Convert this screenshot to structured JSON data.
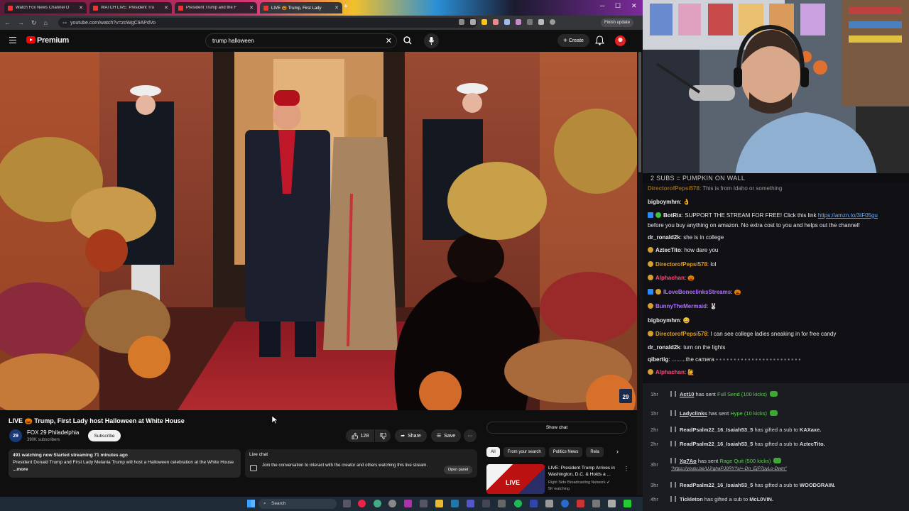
{
  "browser": {
    "tabs": [
      {
        "label": "Watch Fox News Channel O",
        "active": false
      },
      {
        "label": "WATCH LIVE: President Tru",
        "active": false
      },
      {
        "label": "President Trump and the F",
        "active": false
      },
      {
        "label": "LIVE 🎃 Trump, First Lady",
        "active": true
      }
    ],
    "url": "youtube.com/watch?v=zoWgC9APdVo",
    "finish_update": "Finish update"
  },
  "youtube": {
    "logo_text": "Premium",
    "search_value": "trump halloween",
    "create_label": "Create",
    "video_title": "LIVE 🎃 Trump, First Lady host Halloween at White House",
    "channel": {
      "name": "FOX 29 Philadelphia",
      "subs": "390K subscribers",
      "avatar_text": "29"
    },
    "subscribe_label": "Subscribe",
    "like_count": "128",
    "share_label": "Share",
    "save_label": "Save",
    "description": {
      "stats": "491 watching now  Started streaming 71 minutes ago",
      "text": "President Donald Trump and First Lady Melania Trump will host a Halloween celebration at the White House",
      "more": "...more"
    },
    "live_chat": {
      "title": "Live chat",
      "body": "Join the conversation to interact with the creator and others watching this live stream.",
      "open_label": "Open panel"
    },
    "show_chat": "Show chat",
    "chips": [
      "All",
      "From your search",
      "Politics News",
      "Rela"
    ],
    "recommendation": {
      "badge": "LIVE",
      "title": "LIVE: President Trump Arrives in Washington, D.C. & Holds a ...",
      "channel": "Right Side Broadcasting Network",
      "watching": "5K watching"
    },
    "video_watermark": "FOX 29"
  },
  "stream": {
    "subs_goal": "2 SUBS = PUMPKIN ON WALL",
    "chat": [
      {
        "user": "DirectorofPepsi578",
        "color": "#e0a020",
        "text": "This is from Idaho or something",
        "partial": true
      },
      {
        "user": "bigboymhm",
        "color": "#ffffff",
        "text": "👌"
      },
      {
        "user": "BotRix",
        "color": "#ffffff",
        "text": "SUPPORT THE STREAM FOR FREE! Click this link ",
        "link": "https://amzn.to/3tF05gu",
        "text2": "before you buy anything on amazon. No extra cost to you and helps out the channel!"
      },
      {
        "user": "dr_ronald2k",
        "color": "#ffffff",
        "text": "she is in college"
      },
      {
        "user": "AztecTito",
        "color": "#ffffff",
        "text": "how dare you"
      },
      {
        "user": "DirectorofPepsi578",
        "color": "#e0a020",
        "text": "lol"
      },
      {
        "user": "Alphachan",
        "color": "#ff4a7a",
        "text": "🎃"
      },
      {
        "user": "ILoveBoneclinksStreams",
        "color": "#b070ff",
        "text": "🎃"
      },
      {
        "user": "BunnyTheMermaid",
        "color": "#b070ff",
        "text": "🐰"
      },
      {
        "user": "bigboymhm",
        "color": "#ffffff",
        "text": "😀"
      },
      {
        "user": "DirectorofPepsi578",
        "color": "#e0a020",
        "text": "I can see college ladies sneaking in for free candy"
      },
      {
        "user": "dr_ronald2k",
        "color": "#ffffff",
        "text": "turn on the lights"
      },
      {
        "user": "qibertig",
        "color": "#ffffff",
        "text": ".........the camera"
      },
      {
        "user": "Alphachan",
        "color": "#ff4a7a",
        "text": "🙋"
      }
    ],
    "events": [
      {
        "time": "1hr",
        "user": "Act10",
        "action": "has sent",
        "gift": "Full Send (100 kicks)"
      },
      {
        "time": "1hr",
        "user": "Ladyclinks",
        "action": "has sent",
        "gift": "Hype (10 kicks)"
      },
      {
        "time": "2hr",
        "user": "ReadPsalm22_16_Isaiah53_5",
        "action": "has gifted a sub to",
        "target": "KAXaxe."
      },
      {
        "time": "2hr",
        "user": "ReadPsalm22_16_Isaiah53_5",
        "action": "has gifted a sub to",
        "target": "AztecTito."
      },
      {
        "time": "3hr",
        "user": "Xp7Ao",
        "action": "has sent",
        "gift": "Rage Quit (500 kicks)",
        "sub": "\"https://youtu.be/UJrghaPJ0RY?si=-Dn_EjP7pyLo-Dwm\""
      },
      {
        "time": "3hr",
        "user": "ReadPsalm22_16_Isaiah53_5",
        "action": "has gifted a sub to",
        "target": "WOODGRAIN."
      },
      {
        "time": "4hr",
        "user": "Tickleton",
        "action": "has gifted a sub to",
        "target": "McL0VIN."
      }
    ]
  },
  "taskbar": {
    "search_placeholder": "Search"
  }
}
